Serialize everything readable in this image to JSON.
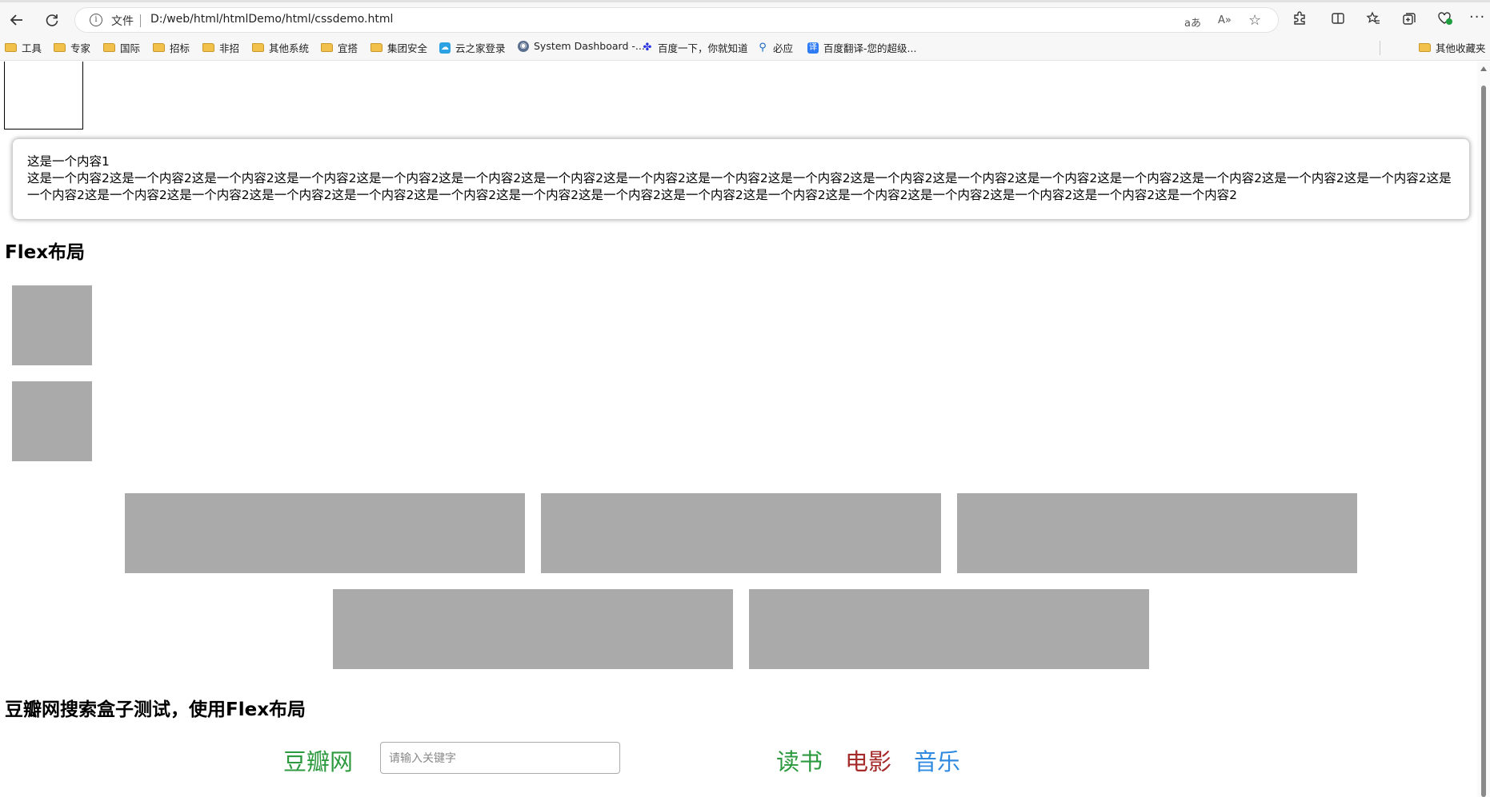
{
  "browser": {
    "address": {
      "file_label": "文件",
      "url": "D:/web/html/htmlDemo/html/cssdemo.html"
    },
    "icons": [
      "back-icon",
      "refresh-icon",
      "info-icon",
      "translate-icon",
      "read-aloud-icon",
      "favorite-star-icon",
      "extensions-icon",
      "split-screen-icon",
      "favorites-icon",
      "collections-icon",
      "browser-essentials-icon",
      "more-icon"
    ],
    "bookmarks": [
      {
        "label": "工具",
        "icon": "folder"
      },
      {
        "label": "专家",
        "icon": "folder"
      },
      {
        "label": "国际",
        "icon": "folder"
      },
      {
        "label": "招标",
        "icon": "folder"
      },
      {
        "label": "非招",
        "icon": "folder"
      },
      {
        "label": "其他系统",
        "icon": "folder"
      },
      {
        "label": "宜搭",
        "icon": "folder"
      },
      {
        "label": "集团安全",
        "icon": "folder"
      },
      {
        "label": "云之家登录",
        "icon": "cloud"
      },
      {
        "label": "System Dashboard -...",
        "icon": "dashboard"
      },
      {
        "label": "百度一下，你就知道",
        "icon": "paw"
      },
      {
        "label": "必应",
        "icon": "search"
      },
      {
        "label": "百度翻译-您的超级...",
        "icon": "translate"
      }
    ],
    "other_favorites": "其他收藏夹"
  },
  "content": {
    "card": {
      "line1": "这是一个内容1",
      "line2": "这是一个内容2这是一个内容2这是一个内容2这是一个内容2这是一个内容2这是一个内容2这是一个内容2这是一个内容2这是一个内容2这是一个内容2这是一个内容2这是一个内容2这是一个内容2这是一个内容2这是一个内容2这是一个内容2这是一个内容2这是一个内容2这是一个内容2这是一个内容2这是一个内容2这是一个内容2这是一个内容2这是一个内容2这是一个内容2这是一个内容2这是一个内容2这是一个内容2这是一个内容2这是一个内容2这是一个内容2这是一个内容2"
    },
    "flex_heading": "Flex布局",
    "douban_heading": "豆瓣网搜索盒子测试，使用Flex布局",
    "douban": {
      "logo": "豆瓣网",
      "search_placeholder": "请输入关键字",
      "nav": [
        {
          "label": "读书",
          "color": "#2d9a3f"
        },
        {
          "label": "电影",
          "color": "#a52a2a"
        },
        {
          "label": "音乐",
          "color": "#2f8ae0"
        }
      ]
    },
    "box_color": "#aaaaaa"
  }
}
